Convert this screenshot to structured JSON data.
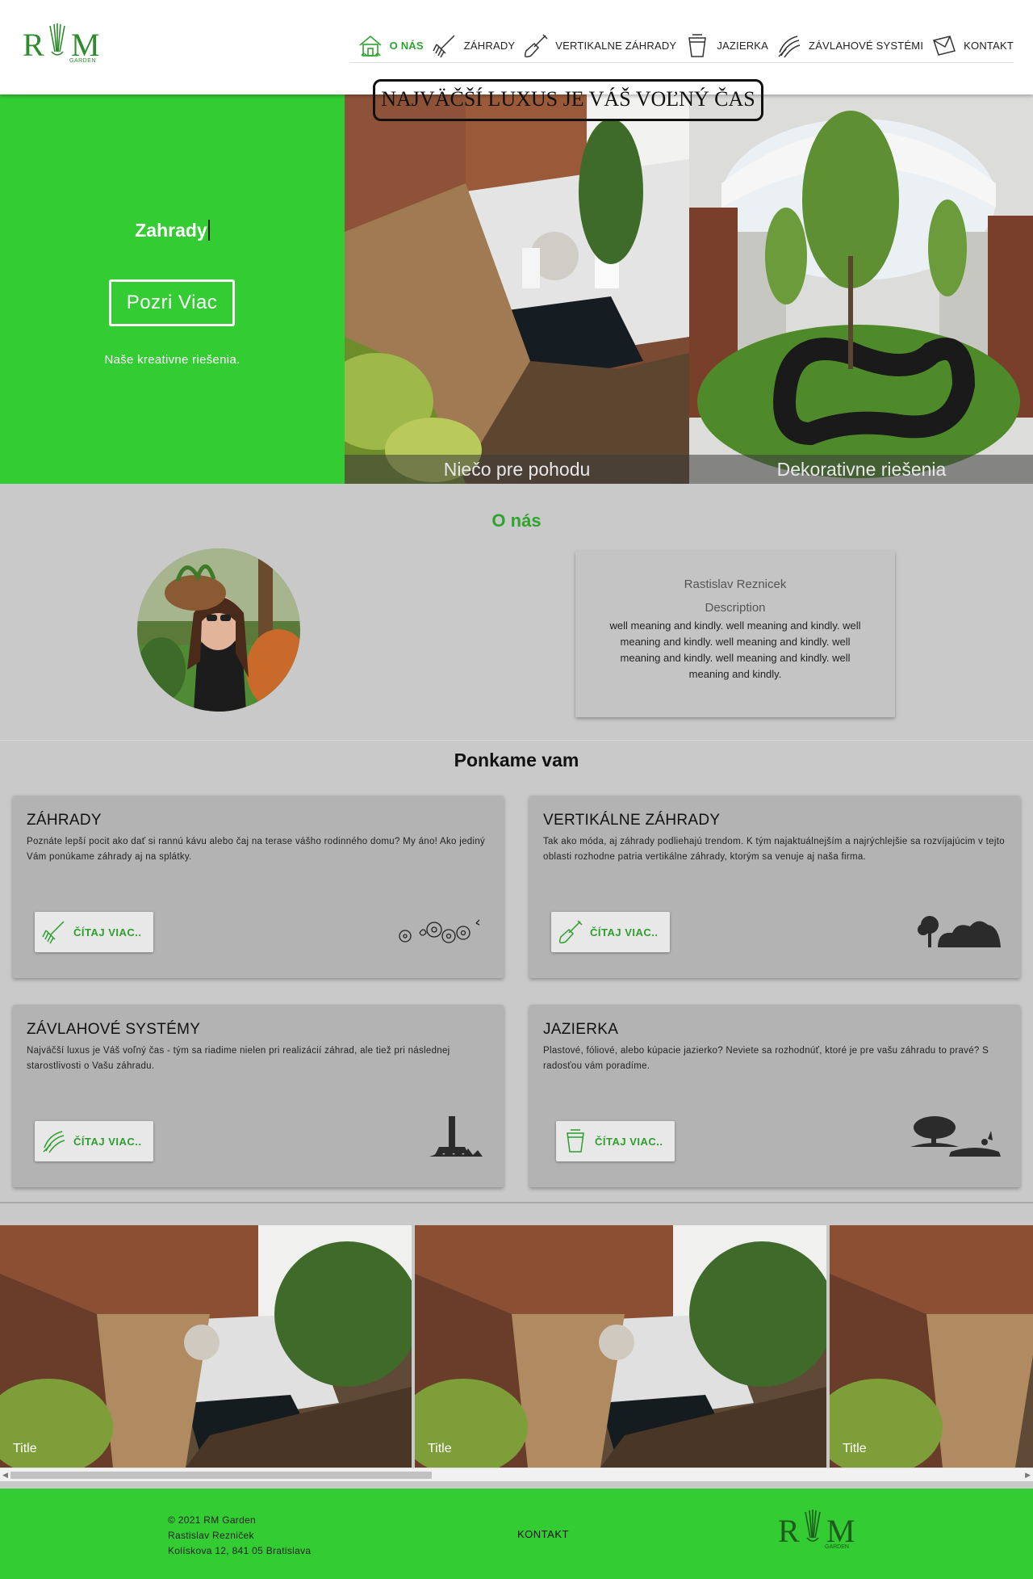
{
  "header": {
    "logo": {
      "left": "R",
      "right": "M",
      "sub": "GARDEN"
    },
    "nav": [
      {
        "label": "O NÁS",
        "icon": "house-icon",
        "active": true
      },
      {
        "label": "ZÁHRADY",
        "icon": "rake-icon"
      },
      {
        "label": "VERTIKALNE ZÁHRADY",
        "icon": "shovel-icon"
      },
      {
        "label": "JAZIERKA",
        "icon": "bucket-icon"
      },
      {
        "label": "ZÁVLAHOVÉ SYSTÉMI",
        "icon": "sprinkler-icon"
      },
      {
        "label": "KONTAKT",
        "icon": "envelope-icon"
      }
    ],
    "banner": "NAJVÄČŠÍ LUXUS JE VÁŠ VOĽNÝ ČAS"
  },
  "hero": {
    "title": "Zahrady",
    "button": "Pozri Viac",
    "subtitle": "Naše kreativne riešenia.",
    "images": [
      {
        "caption": "Niečo pre pohodu"
      },
      {
        "caption": "Dekorativne riešenia"
      }
    ]
  },
  "about": {
    "title": "O nás",
    "name": "Rastislav Reznicek",
    "desc_heading": "Description",
    "desc": "well meaning and kindly. well meaning and kindly. well meaning and kindly. well meaning and kindly. well meaning and kindly. well meaning and kindly. well meaning and kindly."
  },
  "services": {
    "title": "Ponkame vam",
    "read_more": "ČÍTAJ VIAC..",
    "cards": [
      {
        "title": "ZÁHRADY",
        "text": "Poznáte lepší pocit ako dať si rannú kávu alebo čaj na terase vášho rodinného domu? My áno! Ako jediný Vám ponúkame záhrady aj na splátky.",
        "icon": "rake-icon",
        "deco": "flowers-icon"
      },
      {
        "title": "VERTIKÁLNE ZÁHRADY",
        "text": "Tak ako móda, aj záhrady podliehajú trendom. K tým najaktuálnejším a najrýchlejšie sa rozvíjajúcim v tejto oblasti rozhodne patria vertikálne záhrady, ktorým sa venuje aj naša firma.",
        "icon": "shovel-icon",
        "deco": "bushes-icon"
      },
      {
        "title": "ZÁVLAHOVÉ SYSTÉMY",
        "text": "Najväčší luxus je Váš voľný čas - tým sa riadime nielen pri realizácií záhrad, ale tiež pri následnej starostlivosti o Vašu záhradu.",
        "icon": "sprinkler-icon",
        "deco": "sprinkler-head-icon"
      },
      {
        "title": "JAZIERKA",
        "text": "Plastové, fóliové, alebo kúpacie jazierko? Neviete sa rozhodnúť, ktoré je pre vašu záhradu to pravé? S radosťou vám poradíme.",
        "icon": "bucket-icon",
        "deco": "pond-tree-icon"
      }
    ]
  },
  "gallery": {
    "items": [
      {
        "title": "Title"
      },
      {
        "title": "Title"
      },
      {
        "title": "Title"
      }
    ]
  },
  "footer": {
    "copyright": "© 2021 RM Garden",
    "name": "Rastislav Rezniček",
    "address": "Kolískova 12, 841 05 Bratislava",
    "contact": "KONTAKT"
  },
  "colors": {
    "brand_green": "#33cc33",
    "accent_green": "#2ea32e"
  }
}
